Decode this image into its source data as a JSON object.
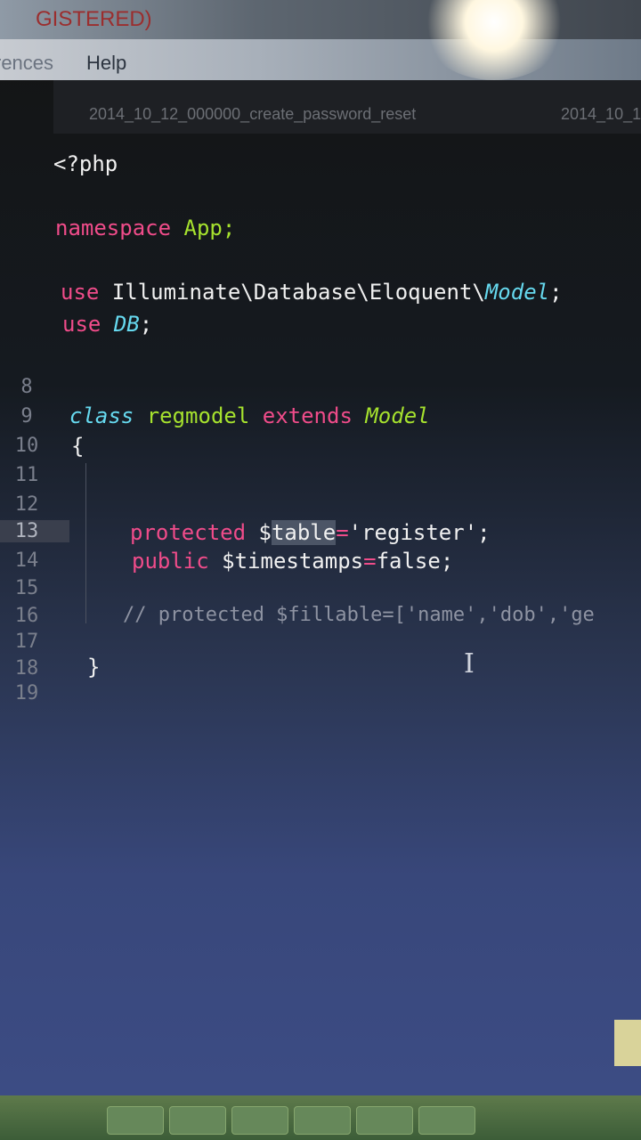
{
  "window": {
    "title": "GISTERED)"
  },
  "menu": {
    "items": [
      "rences",
      "Help"
    ]
  },
  "tabs": [
    "2014_10_12_000000_create_password_reset",
    "2014_10_1"
  ],
  "editor": {
    "line_numbers": [
      "8",
      "9",
      "10",
      "11",
      "12",
      "13",
      "14",
      "15",
      "16",
      "17",
      "18",
      "19"
    ],
    "active_line": "13",
    "code": {
      "php_open": "<?php",
      "namespace_kw": "namespace",
      "namespace_name": "App;",
      "use1_kw": "use",
      "use1_path": "Illuminate\\Database\\Eloquent\\",
      "use1_class": "Model",
      "use1_end": ";",
      "use2_kw": "use",
      "use2_class": "DB",
      "use2_end": ";",
      "class_kw": "class",
      "class_name": "regmodel",
      "extends_kw": "extends",
      "parent_class": "Model",
      "brace_open": "{",
      "line13_kw": "protected",
      "line13_dollar": "$",
      "line13_var": "table",
      "line13_eq": "=",
      "line13_val": "'register'",
      "line13_end": ";",
      "line14_kw": "public",
      "line14_var": "$timestamps",
      "line14_eq": "=",
      "line14_val": "false",
      "line14_end": ";",
      "line16_comment": "// protected $fillable=['name','dob','ge",
      "brace_close": "}"
    }
  },
  "colors": {
    "keyword": "#f04c8a",
    "type": "#66d9ef",
    "class_name": "#a6e22e",
    "string": "#e6db74"
  }
}
